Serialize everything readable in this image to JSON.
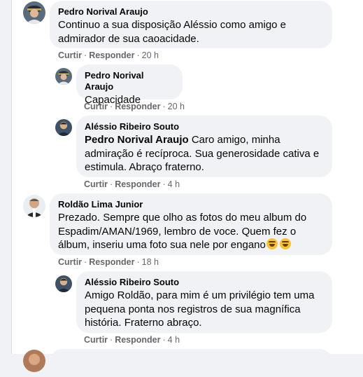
{
  "comments": [
    {
      "author": "Pedro Norival Araujo",
      "text": "Continuo a sua disposição Aléssio como amigo e admirador de sua caoacidade.",
      "like": "Curtir",
      "reply": "Responder",
      "time": "20 h"
    },
    {
      "author": "Pedro Norival Araujo",
      "text": "Capacidade",
      "like": "Curtir",
      "reply": "Responder",
      "time": "20 h"
    },
    {
      "author": "Aléssio Ribeiro Souto",
      "mention": "Pedro Norival Araujo",
      "text": " Caro amigo, minha admiração é recíproca. Sua generosidade cativa e estimula. Abraço fraterno.",
      "like": "Curtir",
      "reply": "Responder",
      "time": "4 h"
    },
    {
      "author": "Roldão Lima Junior",
      "text": "Prezado. Sempre que olho as fotos do meu album do Espadim/AMAN/1969, lembro de voce. Quem fez o álbum, inseriu uma foto sua nele por engano",
      "emojis": [
        "rolling-laughing-emoji",
        "rolling-laughing-emoji"
      ],
      "like": "Curtir",
      "reply": "Responder",
      "time": "18 h"
    },
    {
      "author": "Aléssio Ribeiro Souto",
      "text": "Amigo Roldão, para mim é um privilégio tem uma pequena ponta nos registros de sua magnífica história. Fraterno abraço.",
      "like": "Curtir",
      "reply": "Responder",
      "time": "4 h"
    }
  ],
  "separator": "·",
  "colors": {
    "bubble": "#f0f2f5",
    "meta_text": "#65676b",
    "text": "#050505"
  }
}
